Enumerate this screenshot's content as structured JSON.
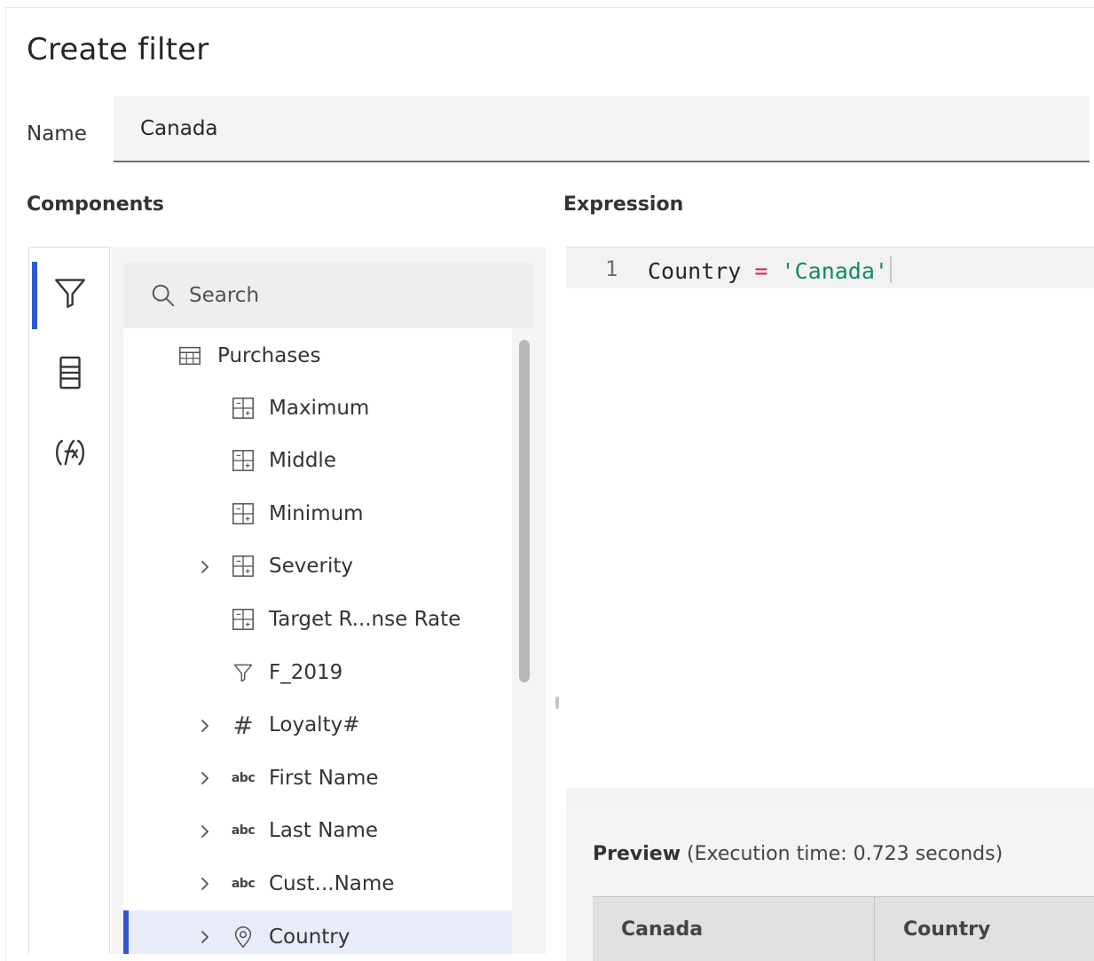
{
  "dialog": {
    "title": "Create filter",
    "name_label": "Name",
    "name_value": "Canada"
  },
  "sections": {
    "components": "Components",
    "expression": "Expression"
  },
  "rail": {
    "items": [
      {
        "icon": "filter-icon",
        "active": true
      },
      {
        "icon": "data-table-icon",
        "active": false
      },
      {
        "icon": "function-icon",
        "active": false
      }
    ]
  },
  "search": {
    "placeholder": "Search"
  },
  "tree": {
    "root": {
      "label": "Purchases",
      "icon": "table-icon"
    },
    "items": [
      {
        "label": "Maximum",
        "icon": "measure-icon",
        "expandable": false
      },
      {
        "label": "Middle",
        "icon": "measure-icon",
        "expandable": false
      },
      {
        "label": "Minimum",
        "icon": "measure-icon",
        "expandable": false
      },
      {
        "label": "Severity",
        "icon": "measure-icon",
        "expandable": true
      },
      {
        "label": "Target R...nse Rate",
        "icon": "measure-icon",
        "expandable": false
      },
      {
        "label": "F_2019",
        "icon": "filter-icon",
        "expandable": false
      },
      {
        "label": "Loyalty#",
        "icon": "number-icon",
        "expandable": true
      },
      {
        "label": "First Name",
        "icon": "text-icon",
        "expandable": true
      },
      {
        "label": "Last Name",
        "icon": "text-icon",
        "expandable": true
      },
      {
        "label": "Cust...Name",
        "icon": "text-icon",
        "expandable": true
      },
      {
        "label": "Country",
        "icon": "location-icon",
        "expandable": true,
        "selected": true
      }
    ],
    "text_icon_glyph": "abc",
    "number_icon_glyph": "#"
  },
  "expression": {
    "line_number": "1",
    "tokens": {
      "identifier": "Country",
      "operator": "=",
      "string": "'Canada'"
    },
    "colors": {
      "operator": "#d02670",
      "string": "#0f8a6a"
    }
  },
  "preview": {
    "label": "Preview",
    "execution": "(Execution time: 0.723 seconds)",
    "columns": [
      "Canada",
      "Country"
    ]
  },
  "colors": {
    "accent": "#2b58d6",
    "selected_bg": "#e8ecf8"
  }
}
